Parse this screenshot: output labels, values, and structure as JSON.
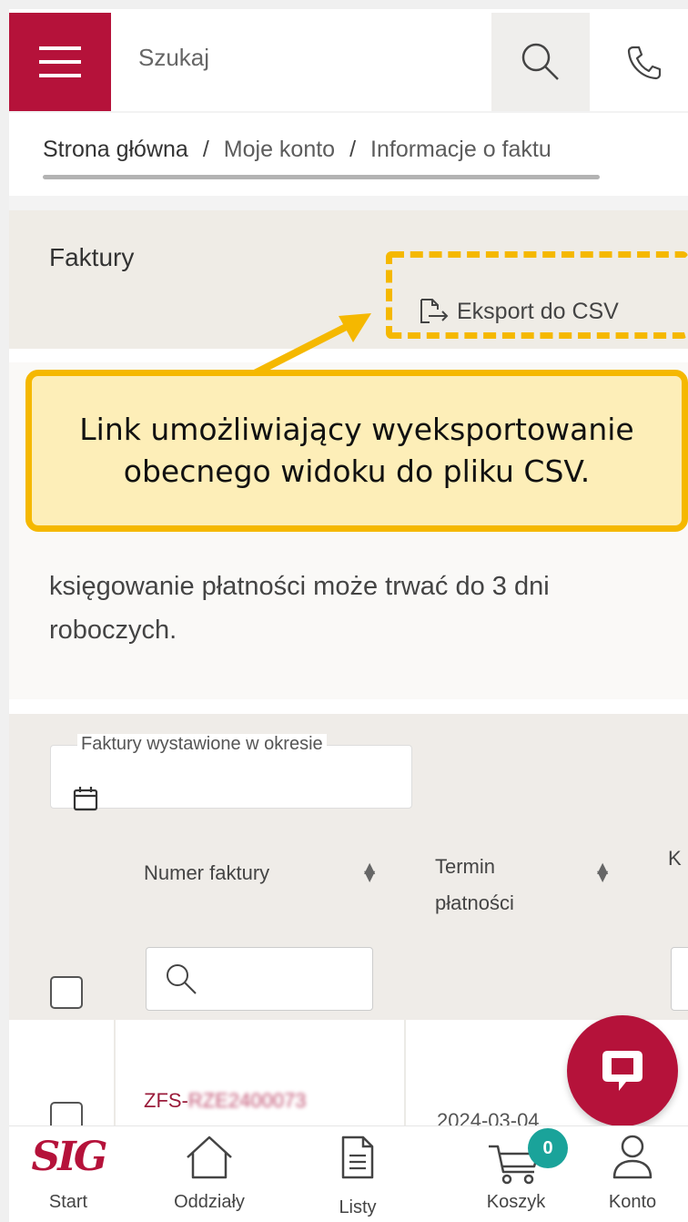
{
  "header": {
    "search_placeholder": "Szukaj",
    "brand_color": "#b5123a"
  },
  "breadcrumb": {
    "items": [
      "Strona główna",
      "Moje konto",
      "Informacje o faktu"
    ],
    "separator": "/"
  },
  "faktury_panel": {
    "title": "Faktury",
    "export_label": "Eksport do CSV"
  },
  "callout": {
    "text": "Link umożliwiający wyeksportowanie obecnego widoku do pliku CSV.",
    "accent": "#f5b800"
  },
  "notice": {
    "text": "księgowanie płatności może trwać do 3 dni roboczych."
  },
  "filters": {
    "period_label": "Faktury wystawione w okresie"
  },
  "table": {
    "columns": [
      "Numer faktury",
      "Termin płatności",
      "K"
    ],
    "rows": [
      {
        "invoice_prefix": "ZFS-",
        "invoice_rest": "RZE2400073",
        "due_date": "2024-03-04"
      }
    ]
  },
  "bottom_nav": {
    "logo_text": "SIG",
    "items": [
      "Start",
      "Oddziały",
      "Listy",
      "Koszyk",
      "Konto"
    ],
    "cart_count": "0",
    "badge_color": "#1aa39a"
  }
}
